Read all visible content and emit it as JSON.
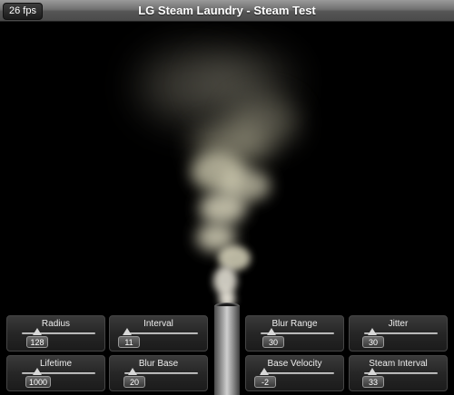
{
  "window": {
    "title": "LG Steam Laundry - Steam Test",
    "fps": "26 fps"
  },
  "controls": [
    {
      "id": "radius",
      "label": "Radius",
      "value": "128"
    },
    {
      "id": "interval",
      "label": "Interval",
      "value": "11"
    },
    {
      "id": "blur-range",
      "label": "Blur Range",
      "value": "30"
    },
    {
      "id": "jitter",
      "label": "Jitter",
      "value": "30"
    },
    {
      "id": "lifetime",
      "label": "Lifetime",
      "value": "1000"
    },
    {
      "id": "blur-base",
      "label": "Blur Base",
      "value": "20"
    },
    {
      "id": "base-velocity",
      "label": "Base Velocity",
      "value": "-2"
    },
    {
      "id": "steam-interval",
      "label": "Steam Interval",
      "value": "33"
    }
  ],
  "colors": {
    "steam": "#e6e2c8",
    "background": "#000000"
  },
  "icons": {
    "emitter": "pipe-icon"
  }
}
